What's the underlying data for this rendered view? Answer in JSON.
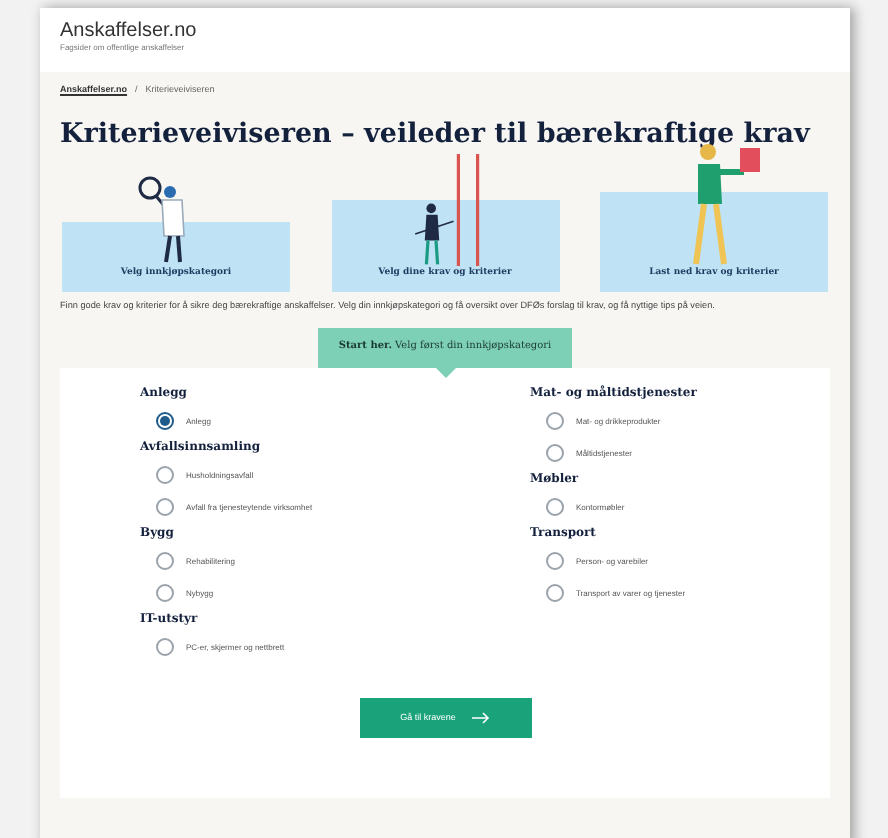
{
  "header": {
    "logo": "Anskaffelser.no",
    "tagline": "Fagsider om offentlige anskaffelser"
  },
  "breadcrumb": [
    {
      "label": "Anskaffelser.no",
      "kind": "link"
    },
    {
      "label": "/",
      "kind": "separator"
    },
    {
      "label": "Kriterieveiviseren",
      "kind": "current"
    }
  ],
  "title": "Kriterieveiviseren – veileder til bærekraftige krav",
  "steps": [
    {
      "label": "Velg innkjøpskategori",
      "kind": "search"
    },
    {
      "label": "Velg dine krav og kriterier",
      "kind": "choose"
    },
    {
      "label": "Last ned krav og kriterier",
      "kind": "download"
    }
  ],
  "intro": "Finn gode krav og kriterier for å sikre deg bærekraftige anskaffelser. Velg din innkjøpskategori og få oversikt over DFØs forslag til krav, og få nyttige tips på veien.",
  "start": {
    "lead": "Start her.",
    "text": "Velg først din innkjøpskategori"
  },
  "columns": [
    [
      {
        "heading": "Anlegg",
        "options": [
          {
            "label": "Anlegg",
            "selected": true
          }
        ]
      },
      {
        "heading": "Avfallsinnsamling",
        "options": [
          {
            "label": "Husholdningsavfall",
            "selected": false
          },
          {
            "label": "Avfall fra tjenesteytende virksomhet",
            "selected": false
          }
        ]
      },
      {
        "heading": "Bygg",
        "options": [
          {
            "label": "Rehabilitering",
            "selected": false
          },
          {
            "label": "Nybygg",
            "selected": false
          }
        ]
      },
      {
        "heading": "IT-utstyr",
        "options": [
          {
            "label": "PC-er, skjermer og nettbrett",
            "selected": false
          }
        ]
      }
    ],
    [
      {
        "heading": "Mat- og måltidstjenester",
        "options": [
          {
            "label": "Mat- og drikkeprodukter",
            "selected": false
          },
          {
            "label": "Måltidstjenester",
            "selected": false
          }
        ]
      },
      {
        "heading": "Møbler",
        "options": [
          {
            "label": "Kontormøbler",
            "selected": false
          }
        ]
      },
      {
        "heading": "Transport",
        "options": [
          {
            "label": "Person- og varebiler",
            "selected": false
          },
          {
            "label": "Transport av varer og tjenester",
            "selected": false
          }
        ]
      }
    ]
  ],
  "button": {
    "label": "Gå til kravene"
  }
}
